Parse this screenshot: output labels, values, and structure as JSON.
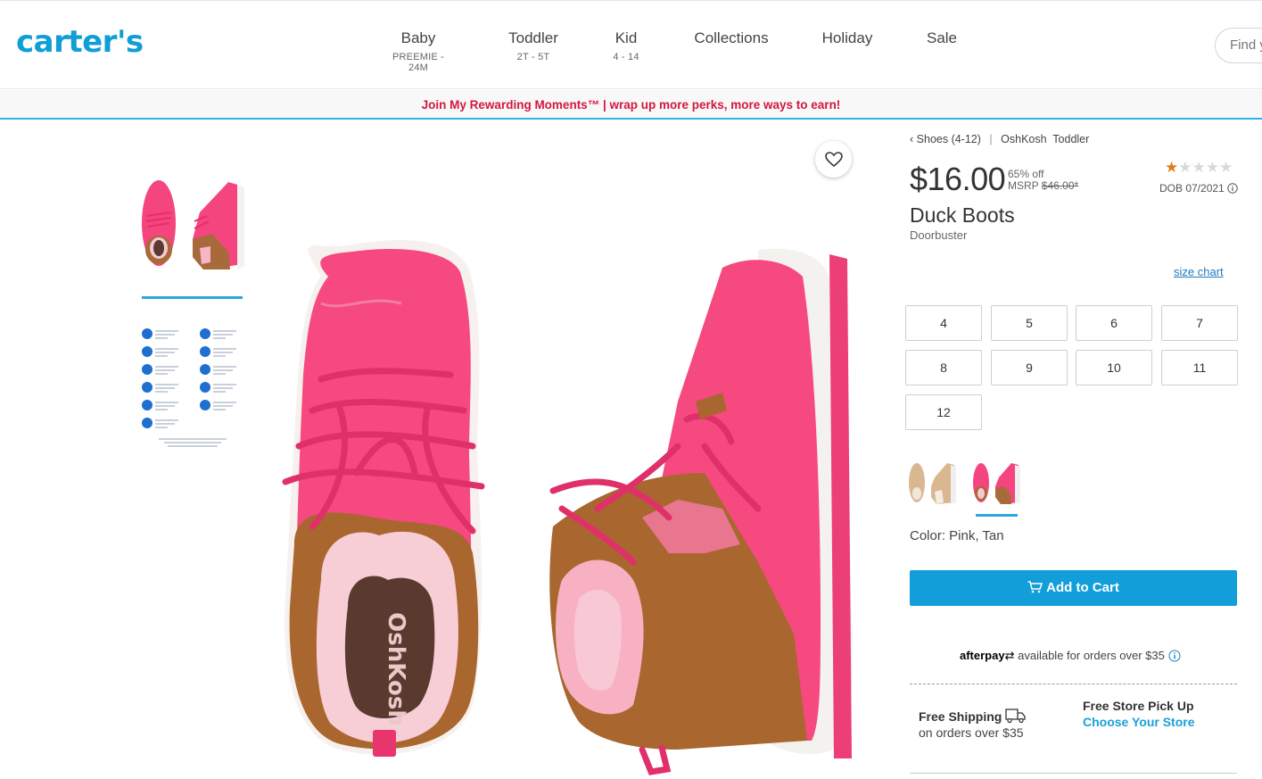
{
  "header": {
    "logo": "carter's",
    "nav": [
      {
        "label": "Baby",
        "sub": "PREEMIE - 24M"
      },
      {
        "label": "Toddler",
        "sub": "2T - 5T"
      },
      {
        "label": "Kid",
        "sub": "4 - 14"
      },
      {
        "label": "Collections",
        "sub": ""
      },
      {
        "label": "Holiday",
        "sub": ""
      },
      {
        "label": "Sale",
        "sub": ""
      }
    ],
    "search_placeholder": "Find y"
  },
  "promo": "Join My Rewarding Moments™ | wrap up more perks, more ways to earn!",
  "breadcrumbs": {
    "back": "Shoes (4-12)",
    "brand": "OshKosh",
    "category": "Toddler"
  },
  "product": {
    "price": "$16.00",
    "discount": "65% off",
    "msrp_label": "MSRP",
    "msrp": "$46.00*",
    "rating": 1,
    "rating_max": 5,
    "dob": "DOB 07/2021",
    "name": "Duck Boots",
    "sub": "Doorbuster",
    "size_chart": "size chart",
    "sizes": [
      "4",
      "5",
      "6",
      "7",
      "8",
      "9",
      "10",
      "11",
      "12"
    ],
    "color_label": "Color: Pink, Tan",
    "add_to_cart": "Add to Cart"
  },
  "afterpay": {
    "brand": "afterpay",
    "text": "available for orders over $35"
  },
  "shipping": {
    "free_shipping": "Free Shipping",
    "free_shipping_sub": "on orders over $35",
    "store_pickup": "Free Store Pick Up",
    "choose_store": "Choose Your Store"
  }
}
